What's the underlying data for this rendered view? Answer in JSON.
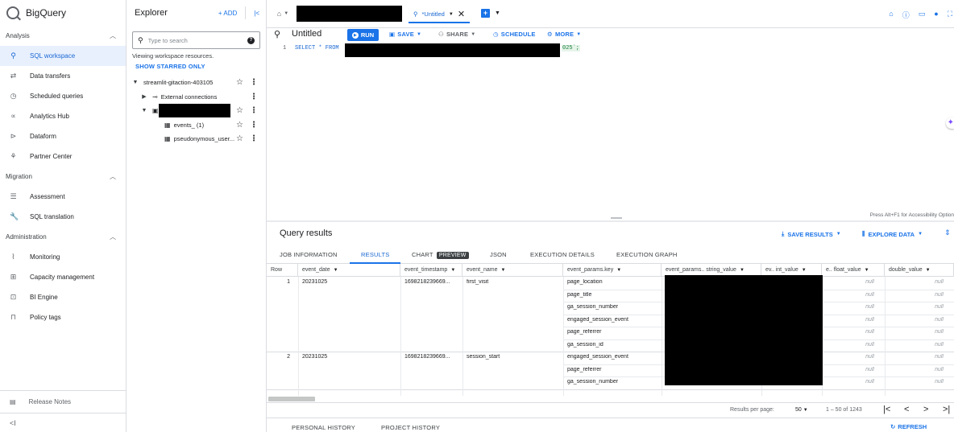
{
  "nav": {
    "brand": "BigQuery",
    "sections": [
      {
        "title": "Analysis",
        "items": [
          {
            "label": "SQL workspace",
            "icon": "search-icon",
            "glyph": "⚲",
            "active": true
          },
          {
            "label": "Data transfers",
            "icon": "transfer-icon",
            "glyph": "⇄"
          },
          {
            "label": "Scheduled queries",
            "icon": "clock-icon",
            "glyph": "◷"
          },
          {
            "label": "Analytics Hub",
            "icon": "hub-icon",
            "glyph": "∝"
          },
          {
            "label": "Dataform",
            "icon": "dataform-icon",
            "glyph": "⊳"
          },
          {
            "label": "Partner Center",
            "icon": "partner-icon",
            "glyph": "⚘"
          }
        ]
      },
      {
        "title": "Migration",
        "items": [
          {
            "label": "Assessment",
            "icon": "list-icon",
            "glyph": "☰"
          },
          {
            "label": "SQL translation",
            "icon": "wrench-icon",
            "glyph": "🔧"
          }
        ]
      },
      {
        "title": "Administration",
        "items": [
          {
            "label": "Monitoring",
            "icon": "chart-icon",
            "glyph": "⌇"
          },
          {
            "label": "Capacity management",
            "icon": "grid-icon",
            "glyph": "⊞"
          },
          {
            "label": "BI Engine",
            "icon": "engine-icon",
            "glyph": "⊡"
          },
          {
            "label": "Policy tags",
            "icon": "lock-icon",
            "glyph": "⊓"
          }
        ]
      }
    ],
    "release_notes": "Release Notes",
    "collapse_glyph": "<I"
  },
  "explorer": {
    "title": "Explorer",
    "add_label": "ADD",
    "search_placeholder": "Type to search",
    "info": "Viewing workspace resources.",
    "starred": "SHOW STARRED ONLY",
    "project": "streamlit-gitaction-403105",
    "external": "External connections",
    "tables": [
      "events_ (1)",
      "pseudonymous_user..."
    ]
  },
  "main": {
    "tab_label": "*Untitled",
    "query_title": "Untitled",
    "run": "RUN",
    "save": "SAVE",
    "share": "SHARE",
    "schedule": "SCHEDULE",
    "more": "MORE",
    "line_number": "1",
    "code": "SELECT * FROM",
    "code_tail": "025`;",
    "hint": "Press Alt+F1 for Accessibility Option",
    "results_title": "Query results",
    "save_results": "SAVE RESULTS",
    "explore_data": "EXPLORE DATA",
    "tabs": [
      "JOB INFORMATION",
      "RESULTS",
      "CHART",
      "JSON",
      "EXECUTION DETAILS",
      "EXECUTION GRAPH"
    ],
    "chart_badge": "PREVIEW",
    "footer_tabs": [
      "PERSONAL HISTORY",
      "PROJECT HISTORY"
    ],
    "refresh": "REFRESH"
  },
  "results": {
    "columns": [
      "Row",
      "event_date",
      "event_timestamp",
      "event_name",
      "event_params.key",
      "event_params.. string_value",
      "ev.. int_value",
      "e.. float_value",
      "double_value"
    ],
    "rows": [
      {
        "row": "1",
        "event_date": "20231025",
        "event_timestamp": "1698218239669...",
        "event_name": "first_visit",
        "keys": [
          "page_location",
          "page_title",
          "ga_session_number",
          "engaged_session_event",
          "page_referrer",
          "ga_session_id"
        ]
      },
      {
        "row": "2",
        "event_date": "20231025",
        "event_timestamp": "1698218239669...",
        "event_name": "session_start",
        "keys": [
          "engaged_session_event",
          "page_referrer",
          "ga_session_number"
        ]
      }
    ],
    "null_text": "null"
  },
  "pager": {
    "label": "Results per page:",
    "per_page": "50",
    "range": "1 – 50 of 1243"
  },
  "colors": {
    "accent": "#1a73e8",
    "active_bg": "#e8f0fe"
  }
}
